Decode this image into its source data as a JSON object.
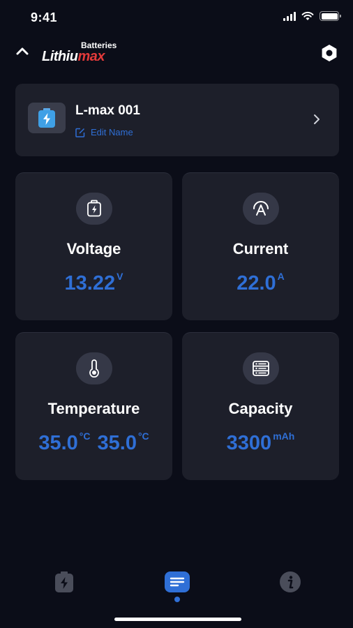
{
  "status_bar": {
    "time": "9:41"
  },
  "header": {
    "logo_top": "Batteries",
    "logo_main_white": "Lithiu",
    "logo_main_red": "max"
  },
  "device": {
    "name": "L-max 001",
    "edit_label": "Edit Name"
  },
  "metrics": [
    {
      "label": "Voltage",
      "value": "13.22",
      "unit": "V",
      "icon": "battery-charge-icon"
    },
    {
      "label": "Current",
      "value": "22.0",
      "unit": "A",
      "icon": "current-arc-icon"
    },
    {
      "label": "Temperature",
      "values": [
        {
          "value": "35.0",
          "unit": "°C"
        },
        {
          "value": "35.0",
          "unit": "°C"
        }
      ],
      "icon": "thermometer-icon"
    },
    {
      "label": "Capacity",
      "value": "3300",
      "unit": "mAh",
      "icon": "stack-list-icon"
    }
  ],
  "bottom_nav": {
    "items": [
      {
        "icon": "battery-tab-icon",
        "active": false
      },
      {
        "icon": "details-tab-icon",
        "active": true
      },
      {
        "icon": "info-tab-icon",
        "active": false
      }
    ]
  },
  "colors": {
    "background": "#0b0d18",
    "card": "#1d1f2a",
    "accent_blue": "#2f6fd6",
    "logo_red": "#e23a3a"
  }
}
